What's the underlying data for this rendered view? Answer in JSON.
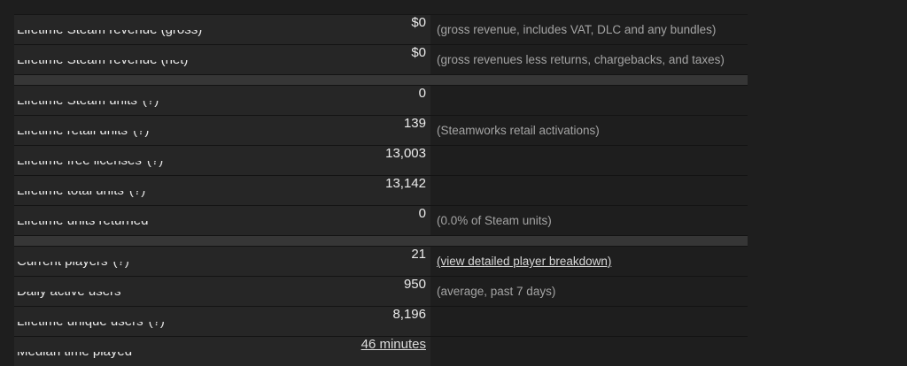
{
  "revenue": [
    {
      "label": "Lifetime Steam revenue (gross)",
      "value": "$0",
      "note": "(gross revenue, includes VAT, DLC and any bundles)"
    },
    {
      "label": "Lifetime Steam revenue (net)",
      "value": "$0",
      "note": "(gross revenues less returns, chargebacks, and taxes)"
    }
  ],
  "units": [
    {
      "label": "Lifetime Steam units",
      "help": "(?)",
      "value": "0",
      "note": ""
    },
    {
      "label": "Lifetime retail units",
      "help": "(?)",
      "value": "139",
      "note": "(Steamworks retail activations)"
    },
    {
      "label": "Lifetime free licenses",
      "help": "(?)",
      "value": "13,003",
      "note": ""
    },
    {
      "label": "Lifetime total units",
      "help": "(?)",
      "value": "13,142",
      "note": ""
    },
    {
      "label": "Lifetime units returned",
      "value": "0",
      "note": "(0.0% of Steam units)"
    }
  ],
  "players": [
    {
      "label": "Current players",
      "help": "(?)",
      "value": "21",
      "note_link": "(view detailed player breakdown)"
    },
    {
      "label": "Daily active users",
      "value": "950",
      "note": "(average, past 7 days)"
    },
    {
      "label": "Lifetime unique users",
      "help": "(?)",
      "value": "8,196",
      "note": ""
    },
    {
      "label": "Median time played",
      "value_link": "46 minutes",
      "note": ""
    }
  ]
}
